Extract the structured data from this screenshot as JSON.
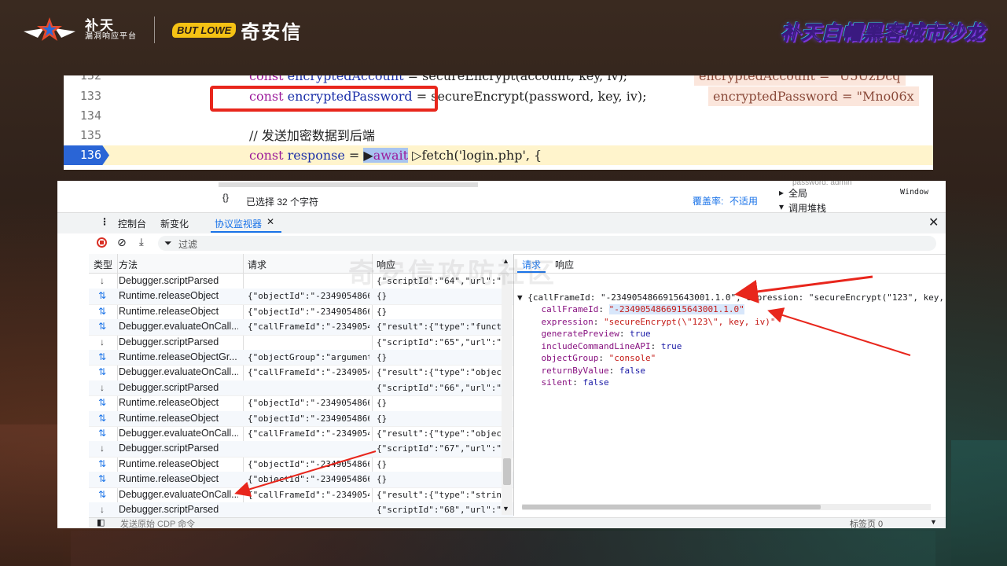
{
  "header": {
    "brand1_line1": "补天",
    "brand1_line2": "漏洞响应平台",
    "brand2_mascot": "BUT LOWE",
    "brand2_name": "奇安信",
    "event_title": "补天白帽黑客城市沙龙"
  },
  "code": {
    "lines": [
      {
        "num": "132",
        "code": "const encryptedAccount = secureEncrypt(account, key, iv);",
        "annotation": "encryptedAccount = \"U5Uz​Dcq"
      },
      {
        "num": "133",
        "code": "const encryptedPassword = secureEncrypt(password, key, iv);",
        "annotation": "encryptedPassword = \"Mno06x"
      },
      {
        "num": "134",
        "code": "",
        "annotation": ""
      },
      {
        "num": "135",
        "code": "// 发送加密数据到后端",
        "annotation": ""
      },
      {
        "num": "136",
        "code": "const response = await fetch('login.php', {",
        "annotation": ""
      }
    ]
  },
  "devtools": {
    "selection_text": "已选择 32 个字符",
    "coverage_label": "覆盖率:",
    "coverage_value": "不适用",
    "right_panel": {
      "global_label": "全局",
      "global_value": "Window",
      "callstack_label": "调用堆栈",
      "password_fragment": "password: admin"
    },
    "tabs": [
      "控制台",
      "新变化",
      "协议监视器"
    ],
    "filter_placeholder": "过滤",
    "columns": {
      "type": "类型",
      "method": "方法",
      "request": "请求",
      "response": "响应"
    },
    "rows": [
      {
        "dir": "down",
        "method": "Debugger.scriptParsed",
        "request": "",
        "response": "{\"scriptId\":\"64\",\"url\":\"..."
      },
      {
        "dir": "swap",
        "method": "Runtime.releaseObject",
        "request": "{\"objectId\":\"-2349054866...",
        "response": "{}"
      },
      {
        "dir": "swap",
        "method": "Runtime.releaseObject",
        "request": "{\"objectId\":\"-2349054866...",
        "response": "{}"
      },
      {
        "dir": "swap",
        "method": "Debugger.evaluateOnCall...",
        "request": "{\"callFrameId\":\"-2349054...",
        "response": "{\"result\":{\"type\":\"funct..."
      },
      {
        "dir": "down",
        "method": "Debugger.scriptParsed",
        "request": "",
        "response": "{\"scriptId\":\"65\",\"url\":\"..."
      },
      {
        "dir": "swap",
        "method": "Runtime.releaseObjectGr...",
        "request": "{\"objectGroup\":\"argument...",
        "response": "{}"
      },
      {
        "dir": "swap",
        "method": "Debugger.evaluateOnCall...",
        "request": "{\"callFrameId\":\"-2349054...",
        "response": "{\"result\":{\"type\":\"objec..."
      },
      {
        "dir": "down",
        "method": "Debugger.scriptParsed",
        "request": "",
        "response": "{\"scriptId\":\"66\",\"url\":\"..."
      },
      {
        "dir": "swap",
        "method": "Runtime.releaseObject",
        "request": "{\"objectId\":\"-2349054866...",
        "response": "{}"
      },
      {
        "dir": "swap",
        "method": "Runtime.releaseObject",
        "request": "{\"objectId\":\"-2349054866...",
        "response": "{}"
      },
      {
        "dir": "swap",
        "method": "Debugger.evaluateOnCall...",
        "request": "{\"callFrameId\":\"-2349054...",
        "response": "{\"result\":{\"type\":\"objec..."
      },
      {
        "dir": "down",
        "method": "Debugger.scriptParsed",
        "request": "",
        "response": "{\"scriptId\":\"67\",\"url\":\"..."
      },
      {
        "dir": "swap",
        "method": "Runtime.releaseObject",
        "request": "{\"objectId\":\"-2349054866...",
        "response": "{}"
      },
      {
        "dir": "swap",
        "method": "Runtime.releaseObject",
        "request": "{\"objectId\":\"-2349054866...",
        "response": "{}"
      },
      {
        "dir": "swap",
        "method": "Debugger.evaluateOnCall...",
        "request": "{\"callFrameId\":\"-2349054...",
        "response": "{\"result\":{\"type\":\"strin..."
      },
      {
        "dir": "down",
        "method": "Debugger.scriptParsed",
        "request": "",
        "response": "{\"scriptId\":\"68\",\"url\":\"..."
      }
    ],
    "detail_tabs": [
      "请求",
      "响应"
    ],
    "detail": {
      "summary": "{callFrameId: \"-2349054866915643001.1.0\", expression: \"secureEncrypt(\"123\", key, iv)\",…",
      "callFrameId_key": "callFrameId",
      "callFrameId_val": "\"-2349054866915643001.1.0\"",
      "expression_key": "expression",
      "expression_val": "\"secureEncrypt(\\\"123\\\", key, iv)\"",
      "generatePreview_key": "generatePreview",
      "generatePreview_val": "true",
      "includeCommandLineAPI_key": "includeCommandLineAPI",
      "includeCommandLineAPI_val": "true",
      "objectGroup_key": "objectGroup",
      "objectGroup_val": "\"console\"",
      "returnByValue_key": "returnByValue",
      "returnByValue_val": "false",
      "silent_key": "silent",
      "silent_val": "false"
    },
    "bottom_input_placeholder": "发送原始 CDP 命令",
    "bottom_target": "标签页 0",
    "watermark": "奇安信攻防社区"
  },
  "colors": {
    "highlight_red": "#e8261c",
    "active_line": "#2a65d6",
    "tab_active": "#1a73e8"
  }
}
